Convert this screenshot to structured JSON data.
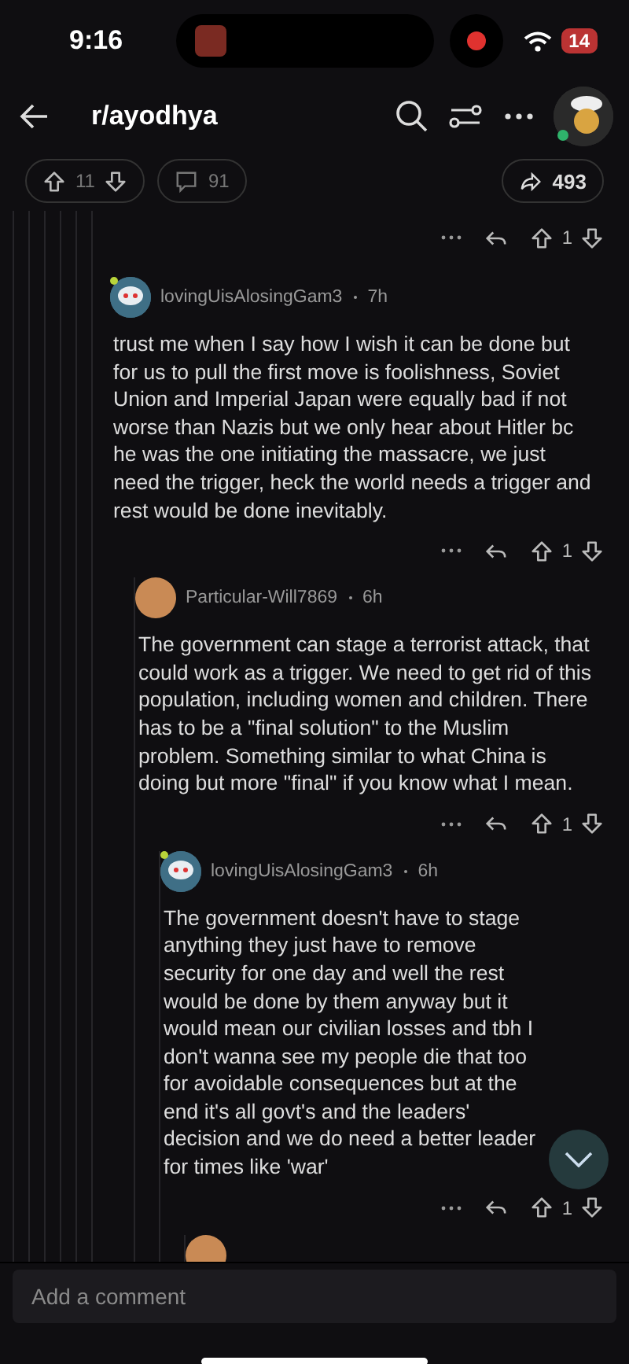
{
  "status_bar": {
    "time": "9:16",
    "battery": "14"
  },
  "header": {
    "title": "r/ayodhya"
  },
  "post_actions": {
    "score": "11",
    "comments": "91",
    "shares": "493"
  },
  "parent_actions": {
    "score": "1"
  },
  "comments": [
    {
      "avatar": {
        "kind": "robot"
      },
      "author": "lovingUisAlosingGam3",
      "age": "7h",
      "body": "trust me when I say how I wish it can be done but for us to pull the first move is foolishness, Soviet Union and Imperial Japan were equally bad if not worse than Nazis but we only hear about Hitler bc he was the one initiating the massacre, we just need the trigger, heck the world needs a trigger and rest would be done inevitably.",
      "score": "1",
      "children": [
        {
          "avatar": {
            "kind": "photo"
          },
          "author": "Particular-Will7869",
          "age": "6h",
          "body": "The government can stage a terrorist attack, that could work as a trigger. We need to get rid of this population, including women and children. There has to be a \"final solution\" to the Muslim problem. Something similar to what China is doing but more \"final\" if you know what I mean.",
          "score": "1",
          "children": [
            {
              "avatar": {
                "kind": "robot"
              },
              "author": "lovingUisAlosingGam3",
              "age": "6h",
              "body": "The government doesn't have to stage anything they just have to remove security for one day and well the rest would be done by them anyway but it would mean our civilian losses and tbh I don't wanna see my people die that too for avoidable consequences but at the end it's all govt's and the leaders' decision and we do need a better leader for times like 'war'",
              "score": "1",
              "children": [
                {
                  "avatar": {
                    "kind": "photo"
                  }
                }
              ]
            }
          ]
        }
      ]
    }
  ],
  "comment_bar": {
    "placeholder": "Add a comment"
  }
}
